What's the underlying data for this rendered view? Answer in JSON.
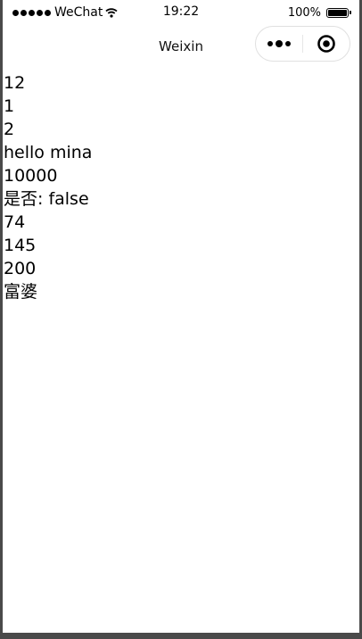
{
  "status_bar": {
    "carrier": "WeChat",
    "time": "19:22",
    "battery_text": "100%"
  },
  "nav": {
    "title": "Weixin"
  },
  "content": {
    "lines": [
      "12",
      "1",
      "2",
      "hello mina",
      "10000",
      "是否: false",
      "74",
      "145",
      "200",
      "富婆"
    ]
  }
}
